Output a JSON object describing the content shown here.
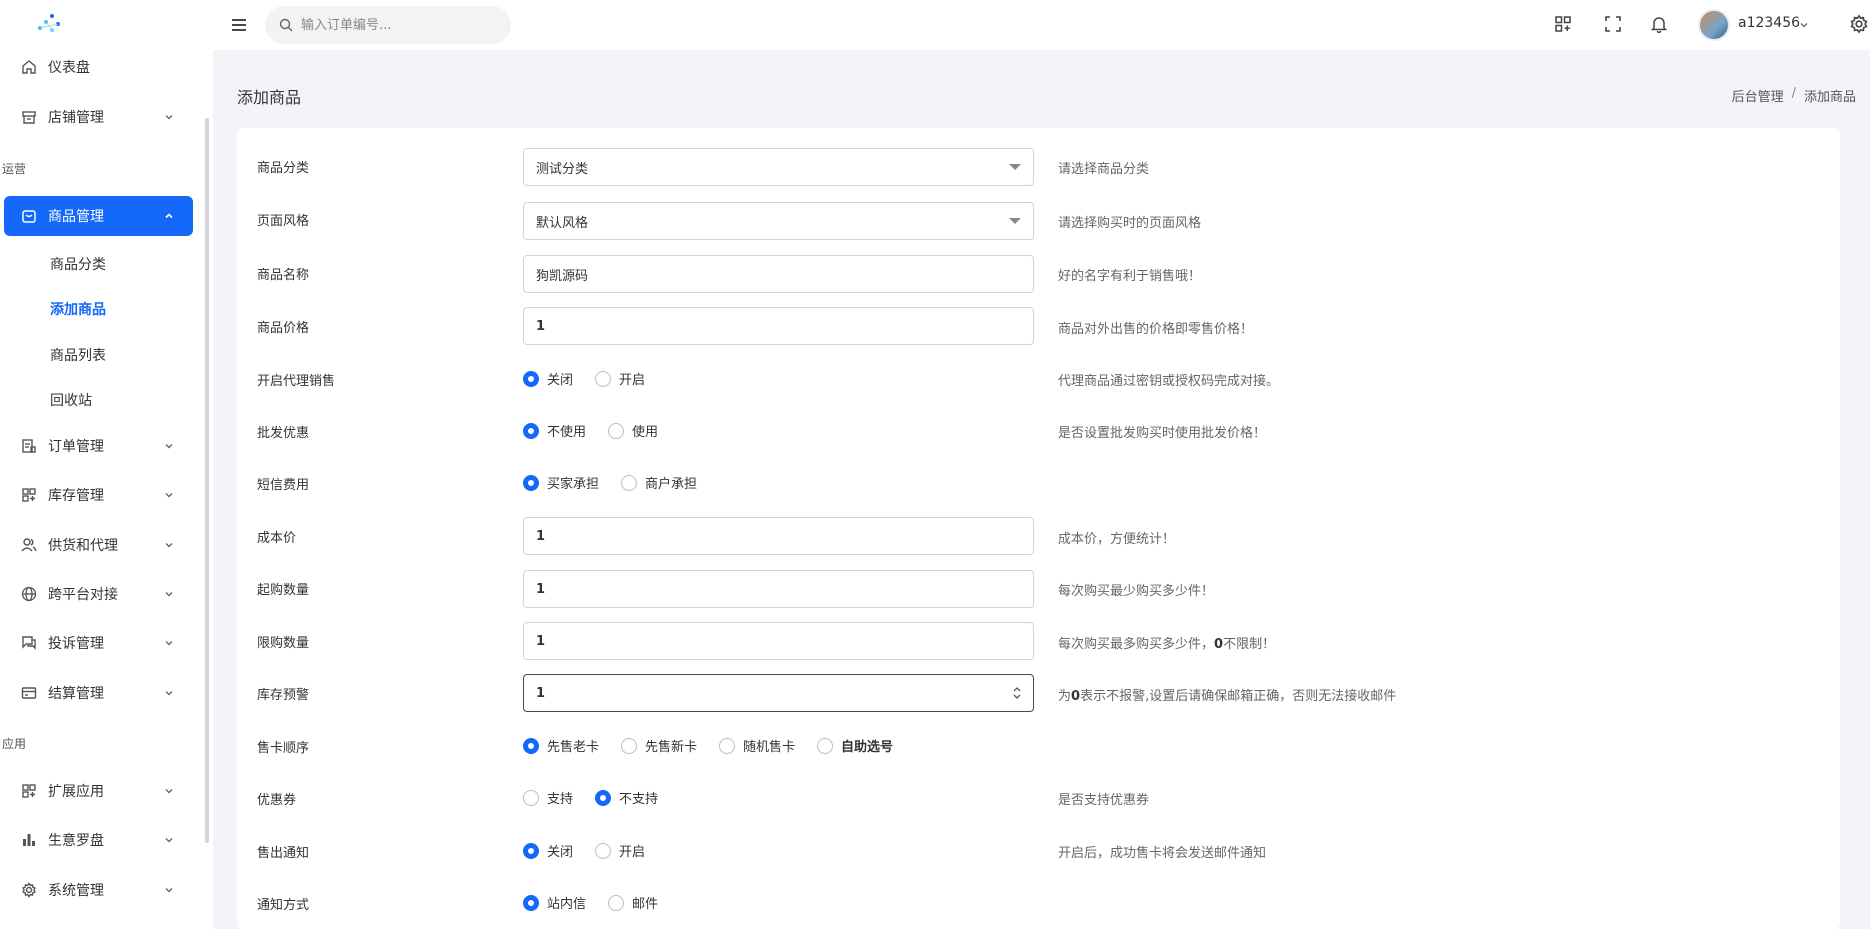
{
  "header": {
    "search_placeholder": "输入订单编号...",
    "username": "a123456"
  },
  "sidebar": {
    "dashboard": "仪表盘",
    "shop": "店铺管理",
    "section_ops": "运营",
    "goods": "商品管理",
    "goods_sub": [
      "商品分类",
      "添加商品",
      "商品列表",
      "回收站"
    ],
    "orders": "订单管理",
    "inventory": "库存管理",
    "supply": "供货和代理",
    "cross": "跨平台对接",
    "complaint": "投诉管理",
    "settle": "结算管理",
    "section_apps": "应用",
    "ext": "扩展应用",
    "compass": "生意罗盘",
    "system": "系统管理"
  },
  "page": {
    "title": "添加商品",
    "breadcrumb": [
      "后台管理",
      "/",
      "添加商品"
    ]
  },
  "form": {
    "category": {
      "label": "商品分类",
      "value": "测试分类",
      "hint": "请选择商品分类"
    },
    "style": {
      "label": "页面风格",
      "value": "默认风格",
      "hint": "请选择购买时的页面风格"
    },
    "name": {
      "label": "商品名称",
      "value": "狗凯源码",
      "hint": "好的名字有利于销售哦！"
    },
    "price": {
      "label": "商品价格",
      "value": "1",
      "hint": "商品对外出售的价格即零售价格！"
    },
    "agent": {
      "label": "开启代理销售",
      "opt1": "关闭",
      "opt2": "开启",
      "hint": "代理商品通过密钥或授权码完成对接。"
    },
    "wholesale": {
      "label": "批发优惠",
      "opt1": "不使用",
      "opt2": "使用",
      "hint": "是否设置批发购买时使用批发价格！"
    },
    "sms": {
      "label": "短信费用",
      "opt1": "买家承担",
      "opt2": "商户承担"
    },
    "cost": {
      "label": "成本价",
      "value": "1",
      "hint": "成本价，方便统计！"
    },
    "min_buy": {
      "label": "起购数量",
      "value": "1",
      "hint": "每次购买最少购买多少件！"
    },
    "max_buy": {
      "label": "限购数量",
      "value": "1",
      "hint_pre": "每次购买最多购买多少件，",
      "hint_bold": "0",
      "hint_post": "不限制！"
    },
    "stock_alert": {
      "label": "库存预警",
      "value": "1",
      "hint_pre": "为",
      "hint_bold": "0",
      "hint_post": "表示不报警,设置后请确保邮箱正确，否则无法接收邮件"
    },
    "sell_order": {
      "label": "售卡顺序",
      "opt1": "先售老卡",
      "opt2": "先售新卡",
      "opt3": "随机售卡",
      "opt4": "自助选号"
    },
    "coupon": {
      "label": "优惠券",
      "opt1": "支持",
      "opt2": "不支持",
      "hint": "是否支持优惠券"
    },
    "sold_notice": {
      "label": "售出通知",
      "opt1": "关闭",
      "opt2": "开启",
      "hint": "开启后，成功售卡将会发送邮件通知"
    },
    "notice_method": {
      "label": "通知方式",
      "opt1": "站内信",
      "opt2": "邮件"
    }
  },
  "colors": {
    "accent": "#1468fa"
  }
}
